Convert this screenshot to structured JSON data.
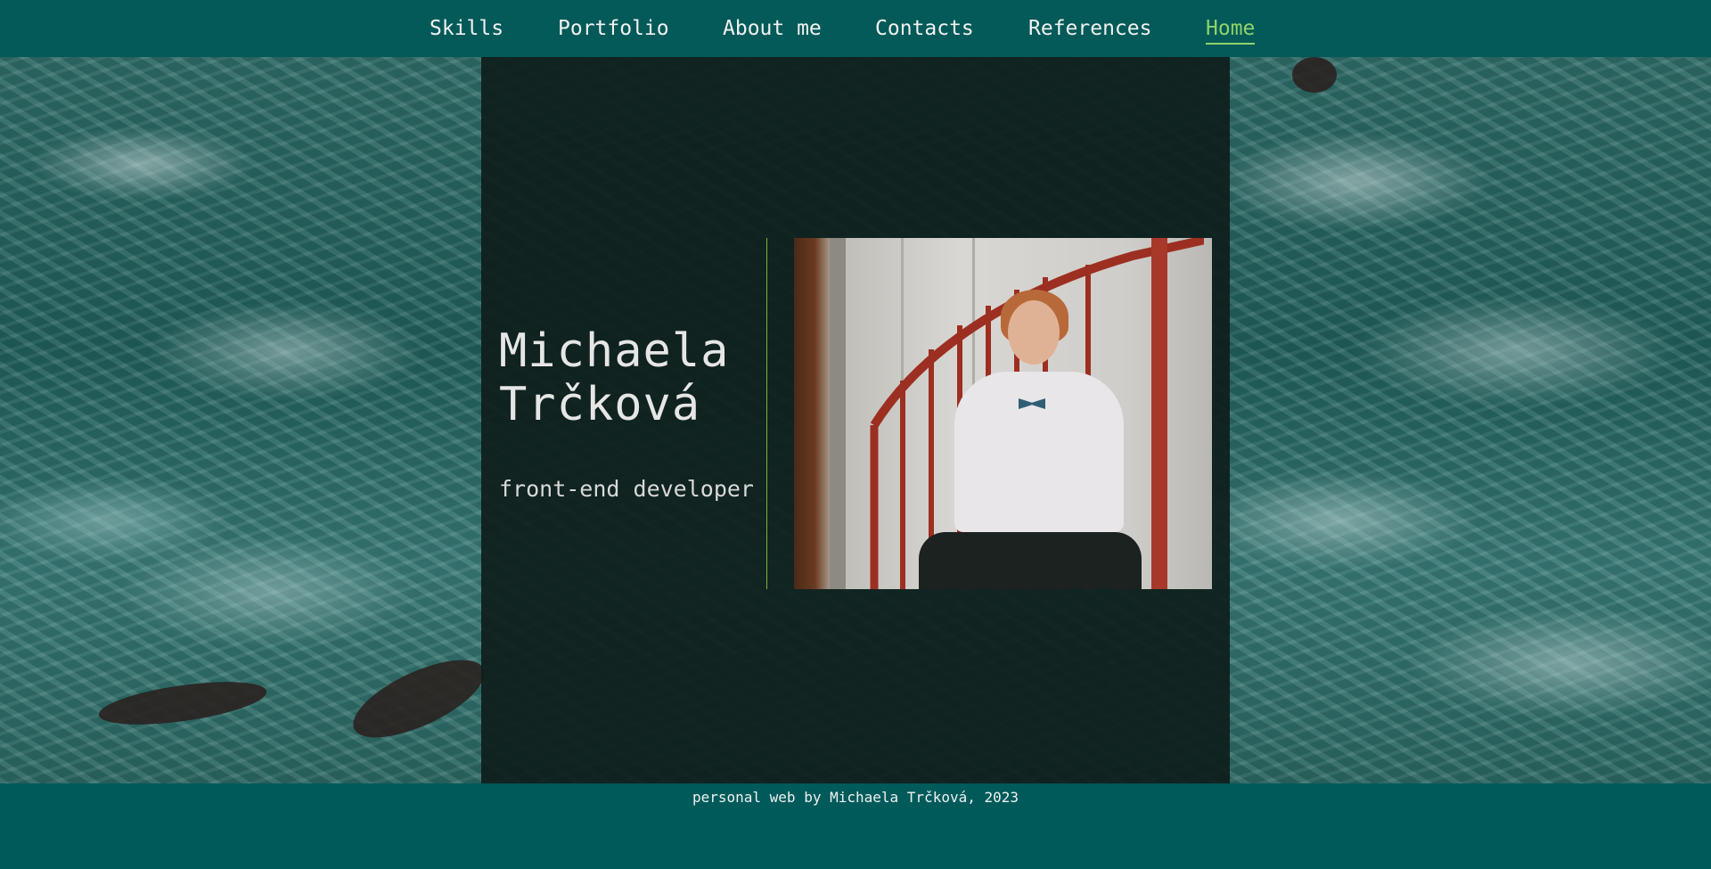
{
  "nav": {
    "items": [
      {
        "label": "Skills"
      },
      {
        "label": "Portfolio"
      },
      {
        "label": "About me"
      },
      {
        "label": "Contacts"
      },
      {
        "label": "References"
      },
      {
        "label": "Home"
      }
    ],
    "active": "Home",
    "active_color": "#8fd36b",
    "background_color": "#035a58"
  },
  "hero": {
    "name": "Michaela\nTrčková",
    "role": "front-end developer",
    "photo_alt": "photo of Michaela Trčková on a red spiral staircase",
    "divider_color": "#7fb33a"
  },
  "footer": {
    "text": "personal web by Michaela Trčková, 2023"
  }
}
